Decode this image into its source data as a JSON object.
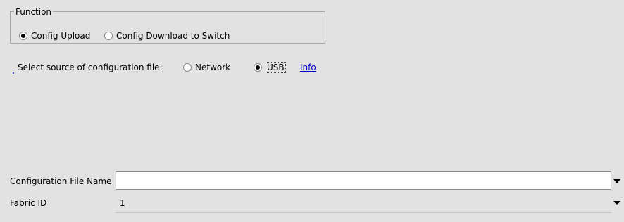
{
  "function_group": {
    "legend": "Function",
    "options": [
      {
        "label": "Config Upload",
        "checked": true
      },
      {
        "label": "Config Download to Switch",
        "checked": false
      }
    ]
  },
  "source": {
    "prompt": "Select source of configuration file:",
    "options": [
      {
        "label": "Network",
        "checked": false
      },
      {
        "label": "USB",
        "checked": true
      }
    ],
    "info_link": "Info"
  },
  "fields": {
    "config_file_name_label": "Configuration File Name",
    "config_file_name_value": "",
    "fabric_id_label": "Fabric ID",
    "fabric_id_value": "1"
  },
  "icons": {
    "dropdown": "chevron-down-icon",
    "radio": "radio-button-icon"
  },
  "colors": {
    "background": "#e2e2e2",
    "link": "#0000cc"
  }
}
